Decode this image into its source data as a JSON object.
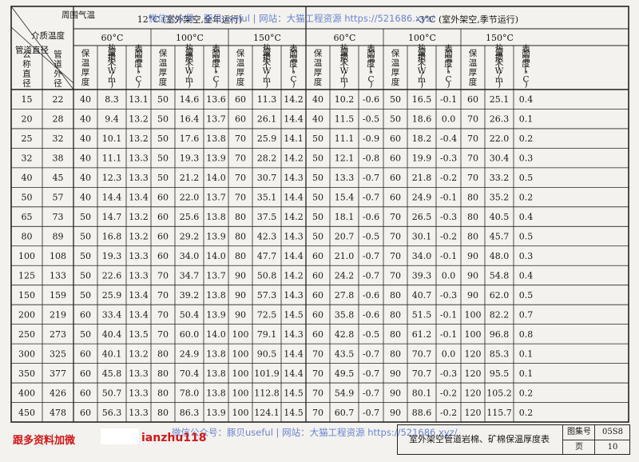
{
  "header": {
    "corner_top": "周围气温",
    "corner_mid": "介质温度",
    "corner_bottom": "管道直径",
    "group1": "12°C  (室外架空,全年运行)",
    "group2": "-3°C  (室外架空,季节运行)",
    "temps": [
      "60°C",
      "100°C",
      "150°C",
      "60°C",
      "100°C",
      "150°C"
    ],
    "col_dn": "公称直径",
    "col_od": "管道外径",
    "col_thick": "保温厚度",
    "col_loss": "热量损失(W/m)",
    "col_surf": "表面温度(°C)"
  },
  "rows": [
    [
      "15",
      "22",
      "40",
      "8.3",
      "13.1",
      "50",
      "14.6",
      "13.6",
      "60",
      "11.3",
      "14.2",
      "40",
      "10.2",
      "-0.6",
      "50",
      "16.5",
      "-0.1",
      "60",
      "25.1",
      "0.4"
    ],
    [
      "20",
      "28",
      "40",
      "9.4",
      "13.2",
      "50",
      "16.4",
      "13.7",
      "60",
      "26.1",
      "14.4",
      "40",
      "11.5",
      "-0.5",
      "50",
      "18.6",
      "0.0",
      "70",
      "26.3",
      "0.1"
    ],
    [
      "25",
      "32",
      "40",
      "10.1",
      "13.2",
      "50",
      "17.6",
      "13.8",
      "70",
      "25.9",
      "14.1",
      "50",
      "11.1",
      "-0.9",
      "60",
      "18.2",
      "-0.4",
      "70",
      "22.0",
      "0.2"
    ],
    [
      "32",
      "38",
      "40",
      "11.1",
      "13.3",
      "50",
      "19.3",
      "13.9",
      "70",
      "28.2",
      "14.2",
      "50",
      "12.1",
      "-0.8",
      "60",
      "19.9",
      "-0.3",
      "70",
      "30.4",
      "0.3"
    ],
    [
      "40",
      "45",
      "40",
      "12.3",
      "13.3",
      "50",
      "21.2",
      "14.0",
      "70",
      "30.7",
      "14.3",
      "50",
      "13.3",
      "-0.7",
      "60",
      "21.8",
      "-0.2",
      "70",
      "33.2",
      "0.5"
    ],
    [
      "50",
      "57",
      "40",
      "14.4",
      "13.4",
      "60",
      "22.0",
      "13.7",
      "70",
      "35.1",
      "14.4",
      "50",
      "15.4",
      "-0.7",
      "60",
      "24.9",
      "-0.1",
      "80",
      "35.2",
      "0.2"
    ],
    [
      "65",
      "73",
      "50",
      "14.7",
      "13.2",
      "60",
      "25.6",
      "13.8",
      "80",
      "37.5",
      "14.2",
      "50",
      "18.1",
      "-0.6",
      "70",
      "26.5",
      "-0.3",
      "80",
      "40.5",
      "0.4"
    ],
    [
      "80",
      "89",
      "50",
      "16.8",
      "13.2",
      "60",
      "29.2",
      "13.9",
      "80",
      "42.3",
      "14.3",
      "50",
      "20.7",
      "-0.5",
      "70",
      "30.1",
      "-0.2",
      "80",
      "45.7",
      "0.5"
    ],
    [
      "100",
      "108",
      "50",
      "19.3",
      "13.3",
      "60",
      "34.0",
      "14.0",
      "80",
      "47.7",
      "14.4",
      "60",
      "21.0",
      "-0.7",
      "70",
      "34.0",
      "-0.1",
      "90",
      "48.0",
      "0.3"
    ],
    [
      "125",
      "133",
      "50",
      "22.6",
      "13.3",
      "70",
      "34.7",
      "13.7",
      "90",
      "50.8",
      "14.2",
      "60",
      "24.2",
      "-0.7",
      "70",
      "39.3",
      "0.0",
      "90",
      "54.8",
      "0.4"
    ],
    [
      "150",
      "159",
      "50",
      "25.9",
      "13.4",
      "70",
      "39.2",
      "13.8",
      "90",
      "57.3",
      "14.3",
      "60",
      "27.8",
      "-0.6",
      "80",
      "40.7",
      "-0.3",
      "90",
      "62.0",
      "0.5"
    ],
    [
      "200",
      "219",
      "60",
      "33.4",
      "13.4",
      "70",
      "50.4",
      "13.9",
      "90",
      "72.5",
      "14.5",
      "60",
      "35.8",
      "-0.6",
      "80",
      "51.5",
      "-0.1",
      "100",
      "82.2",
      "0.7"
    ],
    [
      "250",
      "273",
      "50",
      "40.4",
      "13.5",
      "70",
      "60.0",
      "14.0",
      "100",
      "79.1",
      "14.3",
      "60",
      "42.8",
      "-0.5",
      "80",
      "61.2",
      "-0.1",
      "100",
      "96.8",
      "0.8"
    ],
    [
      "300",
      "325",
      "60",
      "40.1",
      "13.2",
      "80",
      "24.9",
      "13.8",
      "100",
      "90.5",
      "14.4",
      "70",
      "43.5",
      "-0.7",
      "80",
      "70.7",
      "0.0",
      "120",
      "85.3",
      "0.1"
    ],
    [
      "350",
      "377",
      "60",
      "45.8",
      "13.3",
      "80",
      "70.4",
      "13.8",
      "100",
      "101.9",
      "14.4",
      "70",
      "49.5",
      "-0.7",
      "90",
      "70.7",
      "-0.3",
      "120",
      "95.5",
      "0.1"
    ],
    [
      "400",
      "426",
      "60",
      "50.7",
      "13.3",
      "80",
      "78.0",
      "13.8",
      "100",
      "112.8",
      "14.5",
      "70",
      "54.9",
      "-0.7",
      "90",
      "80.1",
      "-0.2",
      "120",
      "105.2",
      "0.2"
    ],
    [
      "450",
      "478",
      "60",
      "56.3",
      "13.3",
      "80",
      "86.3",
      "13.9",
      "100",
      "124.1",
      "14.5",
      "70",
      "60.7",
      "-0.7",
      "90",
      "88.6",
      "-0.2",
      "120",
      "115.7",
      "0.2"
    ]
  ],
  "title_block": {
    "title": "室外架空管道岩棉、矿棉保温厚度表",
    "atlas_label": "图集号",
    "atlas_no": "05S8",
    "page_label": "页",
    "page_no": "10"
  },
  "watermark_top": "微信公众号：豚贝useful  |  网站：大猫工程资源  https://521686.xyz/",
  "watermark_bottom": "微信公众号：豚贝useful  |  网站：大猫工程资源  https://521686.xyz/",
  "ad_text": "跟多资料加微",
  "ad_id": "ianzhu118"
}
